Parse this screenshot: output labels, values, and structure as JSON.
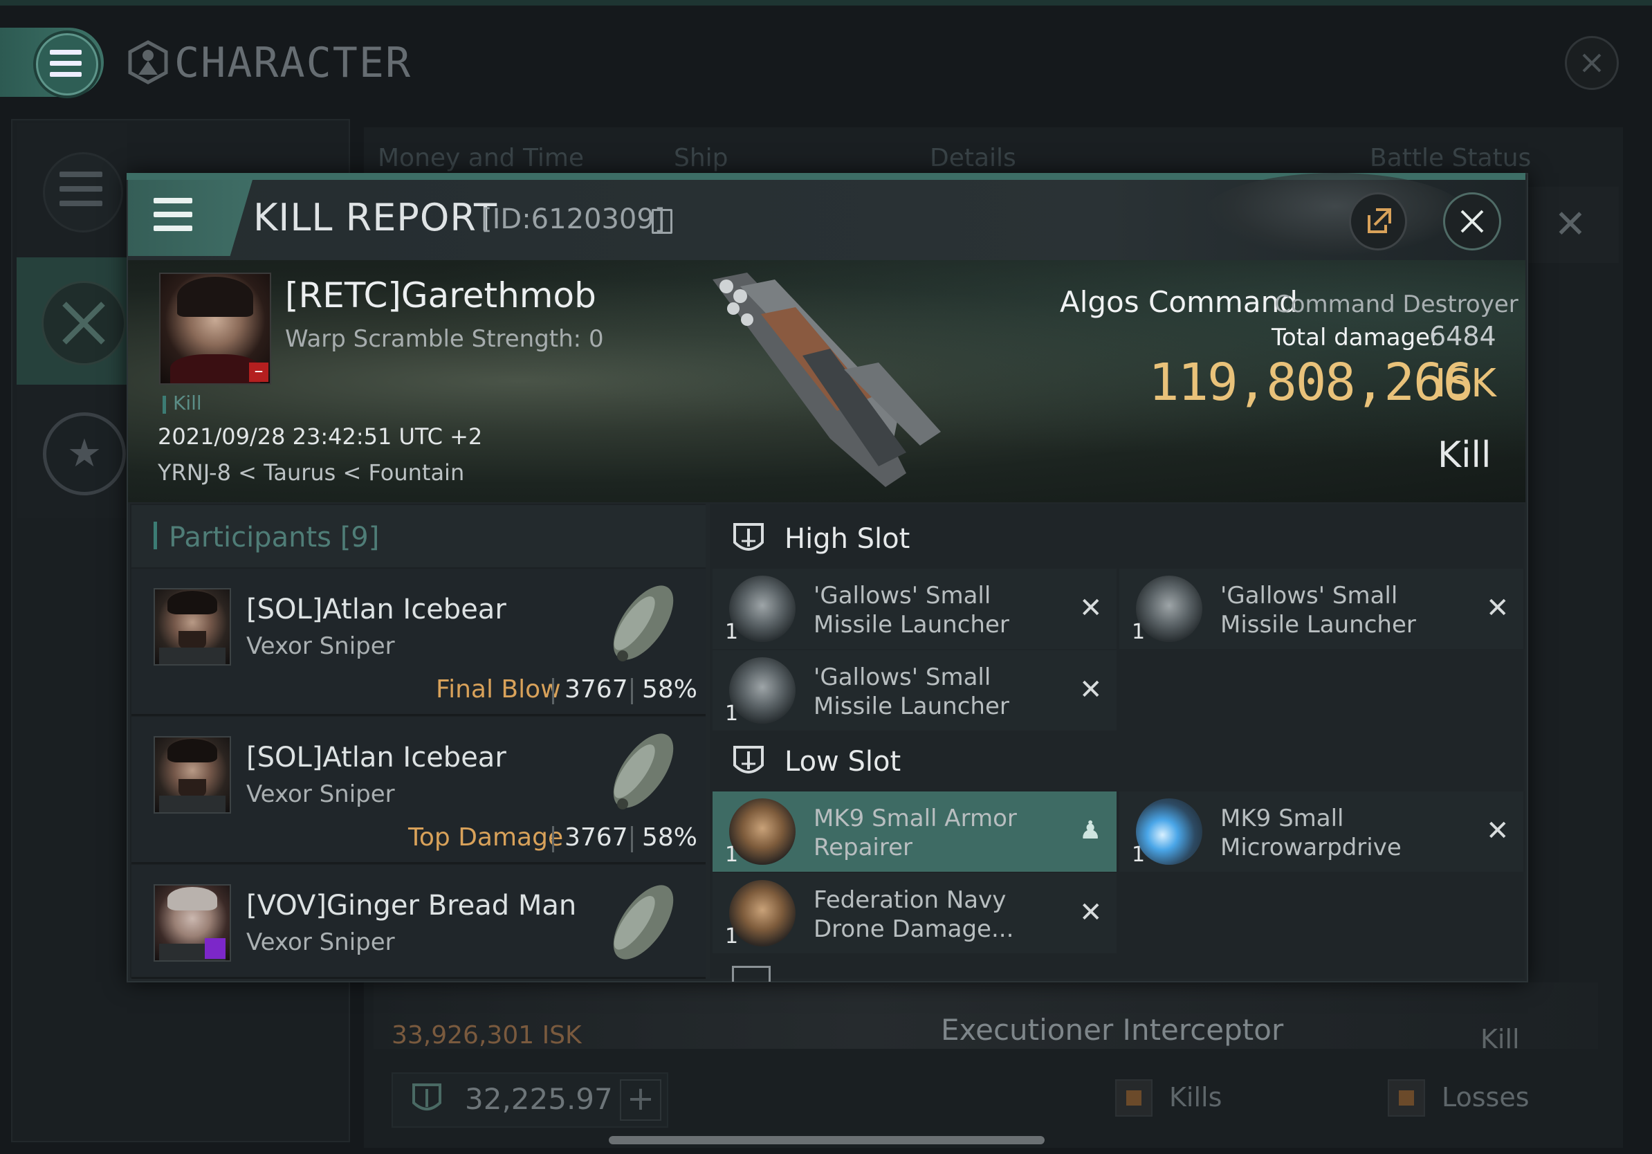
{
  "app": {
    "title": "CHARACTER",
    "tabs": [
      "Money and Time",
      "Ship",
      "Details",
      "Battle Status"
    ]
  },
  "background_row": {
    "isk": "33,926,301 ISK",
    "ship": "Executioner Interceptor",
    "status": "Kill"
  },
  "bottom_bar": {
    "value": "32,225.97",
    "legend_kills": "Kills",
    "legend_losses": "Losses"
  },
  "kill_report": {
    "title": "KILL REPORT",
    "id": "[ID:6120309]",
    "victim": {
      "name": "[RETC]Garethmob",
      "warp_scramble": "Warp Scramble Strength: 0",
      "tag": "Kill",
      "datetime": "2021/09/28 23:42:51 UTC +2",
      "location": "YRNJ-8 < Taurus < Fountain",
      "badge": "–"
    },
    "ship": {
      "name": "Algos Command",
      "class": "Command Destroyer",
      "total_damage_label": "Total damage:",
      "total_damage": "6484",
      "isk_value": "119,808,266",
      "isk_unit": "ISK",
      "result": "Kill"
    },
    "participants": {
      "title": "Participants",
      "count": "[9]",
      "rows": [
        {
          "name": "[SOL]Atlan Icebear",
          "ship": "Vexor Sniper",
          "tag": "Final Blow",
          "damage": "3767",
          "percent": "58%"
        },
        {
          "name": "[SOL]Atlan Icebear",
          "ship": "Vexor Sniper",
          "tag": "Top Damage",
          "damage": "3767",
          "percent": "58%"
        },
        {
          "name": "[VOV]Ginger Bread Man",
          "ship": "Vexor Sniper"
        }
      ]
    },
    "fitting": {
      "high_slot_label": "High Slot",
      "low_slot_label": "Low Slot",
      "high": [
        {
          "qty": "1",
          "name1": "'Gallows' Small",
          "name2": "Missile Launcher",
          "status_icon": "x-icon"
        },
        {
          "qty": "1",
          "name1": "'Gallows' Small",
          "name2": "Missile Launcher",
          "status_icon": "x-icon"
        },
        {
          "qty": "1",
          "name1": "'Gallows' Small",
          "name2": "Missile Launcher",
          "status_icon": "x-icon"
        }
      ],
      "low": [
        {
          "qty": "1",
          "name1": "MK9 Small Armor",
          "name2": "Repairer",
          "status_icon": "person-icon"
        },
        {
          "qty": "1",
          "name1": "MK9 Small",
          "name2": "Microwarpdrive",
          "status_icon": "x-icon"
        },
        {
          "qty": "1",
          "name1": "Federation Navy",
          "name2": "Drone Damage...",
          "status_icon": "x-icon"
        }
      ]
    }
  },
  "colors": {
    "accent": "#3e6b64",
    "isk_gold": "#e9c27a",
    "tag_orange": "#d9a25a",
    "victim_badge": "#b41f1f",
    "participant_badge": "#7c27c9"
  }
}
